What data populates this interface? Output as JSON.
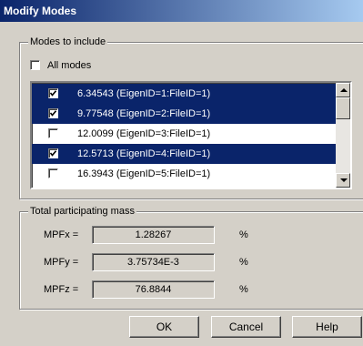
{
  "window": {
    "title": "Modify Modes"
  },
  "modes_group": {
    "label": "Modes to include",
    "all_modes": {
      "label": "All modes",
      "checked": false
    },
    "modes": [
      {
        "label": "6.34543 (EigenID=1:FileID=1)",
        "checked": true,
        "selected": true
      },
      {
        "label": "9.77548 (EigenID=2:FileID=1)",
        "checked": true,
        "selected": true
      },
      {
        "label": "12.0099 (EigenID=3:FileID=1)",
        "checked": false,
        "selected": false
      },
      {
        "label": "12.5713 (EigenID=4:FileID=1)",
        "checked": true,
        "selected": true
      },
      {
        "label": "16.3943 (EigenID=5:FileID=1)",
        "checked": false,
        "selected": false
      }
    ]
  },
  "mass_group": {
    "label": "Total participating mass",
    "fields": [
      {
        "label": "MPFx =",
        "value": "1.28267",
        "unit": "%"
      },
      {
        "label": "MPFy =",
        "value": "3.75734E-3",
        "unit": "%"
      },
      {
        "label": "MPFz =",
        "value": "76.8844",
        "unit": "%"
      }
    ]
  },
  "buttons": {
    "ok": "OK",
    "cancel": "Cancel",
    "help": "Help"
  },
  "colors": {
    "selection": "#0a246a",
    "dialog_bg": "#d4d0c8",
    "title_gradient_start": "#0a246a",
    "title_gradient_end": "#a6caf0"
  }
}
